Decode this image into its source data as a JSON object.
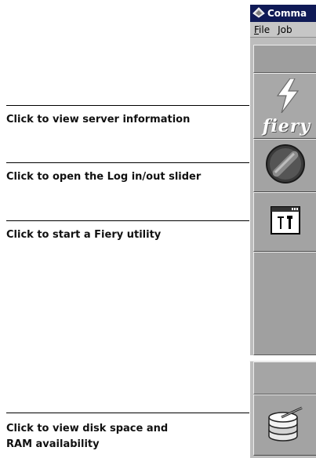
{
  "window": {
    "title": "Comma",
    "menu": [
      "File",
      "Job"
    ]
  },
  "callouts": {
    "server_info": "Click to view server information",
    "login_slider": "Click to open the Log in/out slider",
    "fiery_utility": "Click to start a Fiery utility",
    "disk_ram_line1": "Click to view disk space and",
    "disk_ram_line2": "RAM availability"
  },
  "fiery_logo_text": "fiery",
  "icons": {
    "app": "command-workstation-icon",
    "server": "fiery-lightning-icon",
    "login": "log-in-out-knob-icon",
    "utility": "fiery-utility-icon",
    "disk": "disk-stack-icon"
  },
  "colors": {
    "titlebar": "#0f1a56",
    "strip": "#bdbdbd",
    "panel": "#9e9e9e"
  }
}
